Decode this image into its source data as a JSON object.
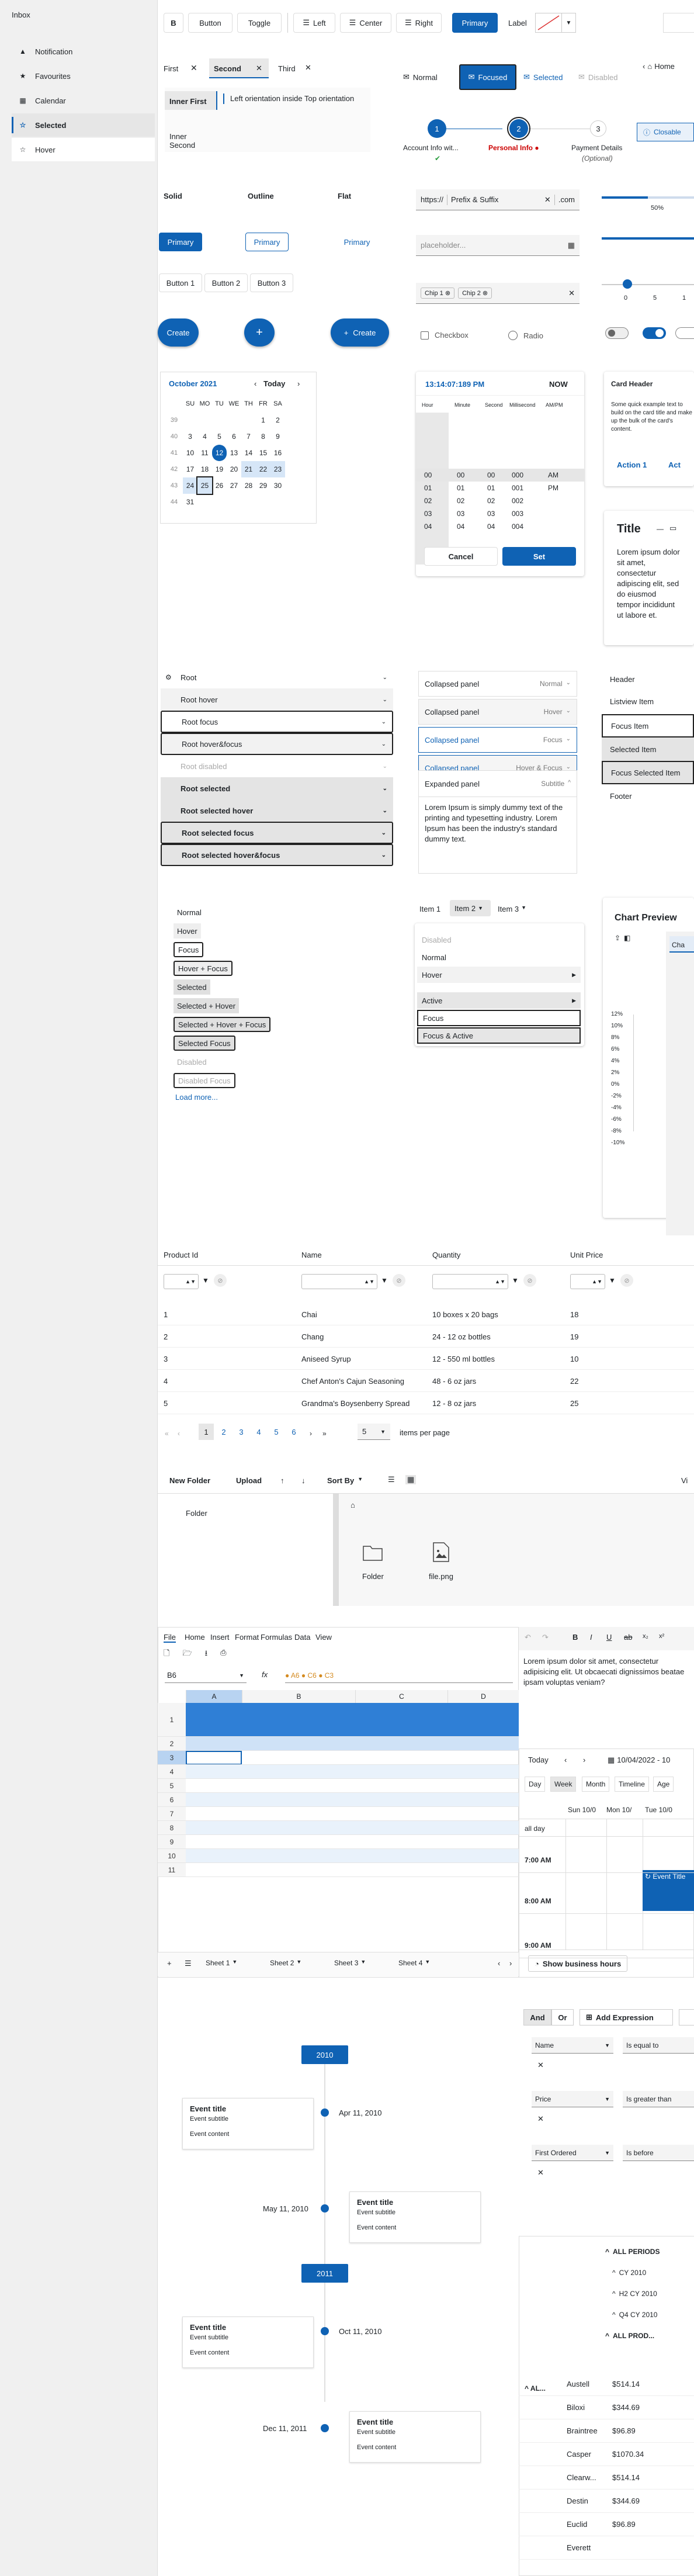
{
  "drawer": {
    "title": "Inbox",
    "items": [
      {
        "label": "Notification",
        "icon": "bell-icon",
        "glyph": "▲"
      },
      {
        "label": "Favourites",
        "icon": "star-icon",
        "glyph": "★"
      },
      {
        "label": "Calendar",
        "icon": "calendar-icon",
        "glyph": "▦"
      },
      {
        "label": "Selected",
        "icon": "star-outline-icon",
        "glyph": "☆"
      },
      {
        "label": "Hover",
        "icon": "star-outline-icon",
        "glyph": "☆"
      }
    ]
  },
  "toolbar": {
    "bold": "B",
    "button": "Button",
    "toggle": "Toggle",
    "left": "Left",
    "center": "Center",
    "right": "Right",
    "primary": "Primary",
    "label": "Label"
  },
  "tabs": {
    "row1": [
      "First",
      "Second",
      "Third"
    ],
    "inner": [
      "Inner First",
      "Inner Second"
    ],
    "inner_content": "Left orientation inside Top orientation"
  },
  "chips_row": {
    "normal": "Normal",
    "focused": "Focused",
    "selected": "Selected",
    "disabled": "Disabled"
  },
  "breadcrumb": {
    "home": "Home"
  },
  "stepper": [
    {
      "num": "1",
      "label": "Account Info wit...",
      "sub": ""
    },
    {
      "num": "2",
      "label": "Personal Info",
      "sub": ""
    },
    {
      "num": "3",
      "label": "Payment Details",
      "sub": "(Optional)"
    }
  ],
  "closable": "Closable",
  "buttons": {
    "solid": "Solid",
    "outline": "Outline",
    "flat": "Flat",
    "primary_solid": "Primary",
    "primary_outline": "Primary",
    "primary_flat": "Primary",
    "group": [
      "Button 1",
      "Button 2",
      "Button 3"
    ],
    "fab_create": "Create",
    "fab_plus": "+",
    "fab_create2": "Create"
  },
  "inputs": {
    "prefix": "https://",
    "suffix_text": "Prefix & Suffix",
    "suffix": ".com",
    "placeholder": "placeholder...",
    "chips": [
      "Chip 1",
      "Chip 2"
    ],
    "checkbox": "Checkbox",
    "radio": "Radio"
  },
  "progress": {
    "label": "50%",
    "value": 0.5
  },
  "slider": {
    "ticks": [
      "0",
      "5",
      "1"
    ]
  },
  "calendar": {
    "month": "October 2021",
    "today": "Today",
    "days": [
      "SU",
      "MO",
      "TU",
      "WE",
      "TH",
      "FR",
      "SA"
    ],
    "weeks": [
      {
        "w": "39",
        "d": [
          "",
          "",
          "",
          "",
          "",
          "1",
          "2"
        ]
      },
      {
        "w": "40",
        "d": [
          "3",
          "4",
          "5",
          "6",
          "7",
          "8",
          "9"
        ]
      },
      {
        "w": "41",
        "d": [
          "10",
          "11",
          "12",
          "13",
          "14",
          "15",
          "16"
        ]
      },
      {
        "w": "42",
        "d": [
          "17",
          "18",
          "19",
          "20",
          "21",
          "22",
          "23"
        ]
      },
      {
        "w": "43",
        "d": [
          "24",
          "25",
          "26",
          "27",
          "28",
          "29",
          "30"
        ]
      },
      {
        "w": "44",
        "d": [
          "31",
          "",
          "",
          "",
          "",
          "",
          ""
        ]
      }
    ]
  },
  "time_picker": {
    "value": "13:14:07:189 PM",
    "now": "NOW",
    "headers": [
      "Hour",
      "Minute",
      "Second",
      "Millisecond",
      "AM/PM"
    ],
    "rows": [
      [
        "00",
        "00",
        "00",
        "000",
        "AM"
      ],
      [
        "01",
        "01",
        "01",
        "001",
        "PM"
      ],
      [
        "02",
        "02",
        "02",
        "002",
        ""
      ],
      [
        "03",
        "03",
        "03",
        "003",
        ""
      ],
      [
        "04",
        "04",
        "04",
        "004",
        ""
      ]
    ],
    "cancel": "Cancel",
    "set": "Set"
  },
  "card": {
    "header": "Card Header",
    "body": "Some quick example text to build on the card title and make up the bulk of the card's content.",
    "action1": "Action 1",
    "action2": "Act"
  },
  "dialog": {
    "title": "Title",
    "body": "Lorem ipsum dolor sit amet, consectetur adipiscing elit, sed do eiusmod tempor incididunt ut labore et."
  },
  "tree": {
    "items": [
      "Root",
      "Root hover",
      "Root focus",
      "Root hover&focus",
      "Root disabled",
      "Root selected",
      "Root selected hover",
      "Root selected focus",
      "Root selected hover&focus"
    ]
  },
  "panels": {
    "items": [
      {
        "label": "Collapsed panel",
        "state": "Normal"
      },
      {
        "label": "Collapsed panel",
        "state": "Hover"
      },
      {
        "label": "Collapsed panel",
        "state": "Focus"
      },
      {
        "label": "Collapsed panel",
        "state": "Hover & Focus"
      },
      {
        "label": "Expanded panel",
        "state": "Subtitle"
      }
    ],
    "content": "Lorem Ipsum is simply dummy text of the printing and typesetting industry. Lorem Ipsum has been the industry's standard dummy text."
  },
  "listview": {
    "items": [
      "Header",
      "Listview Item",
      "Focus Item",
      "Selected Item",
      "Focus Selected Item",
      "Footer"
    ]
  },
  "list": {
    "items": [
      "Normal",
      "Hover",
      "Focus",
      "Hover + Focus",
      "Selected",
      "Selected + Hover",
      "Selected + Hover + Focus",
      "Selected Focus",
      "Disabled",
      "Disabled Focus"
    ],
    "load_more": "Load more..."
  },
  "menu": {
    "bar": [
      "Item 1",
      "Item 2",
      "Item 3"
    ],
    "items": [
      "Disabled",
      "Normal",
      "Hover",
      "Active",
      "Focus",
      "Focus & Active"
    ]
  },
  "chart_preview": {
    "title": "Chart Preview",
    "tab": "Cha",
    "ticks": [
      "12%",
      "10%",
      "8%",
      "6%",
      "4%",
      "2%",
      "0%",
      "-2%",
      "-4%",
      "-6%",
      "-8%",
      "-10%"
    ]
  },
  "grid": {
    "headers": [
      "Product Id",
      "Name",
      "Quantity",
      "Unit Price"
    ],
    "rows": [
      [
        "1",
        "Chai",
        "10 boxes x 20 bags",
        "18"
      ],
      [
        "2",
        "Chang",
        "24 - 12 oz bottles",
        "19"
      ],
      [
        "3",
        "Aniseed Syrup",
        "12 - 550 ml bottles",
        "10"
      ],
      [
        "4",
        "Chef Anton's Cajun Seasoning",
        "48 - 6 oz jars",
        "22"
      ],
      [
        "5",
        "Grandma's Boysenberry Spread",
        "12 - 8 oz jars",
        "25"
      ]
    ],
    "pages": [
      "1",
      "2",
      "3",
      "4",
      "5",
      "6"
    ],
    "page_size": "5",
    "per_page": "items per page"
  },
  "file_manager": {
    "new_folder": "New Folder",
    "upload": "Upload",
    "sort_by": "Sort By",
    "view": "Vi",
    "tree_item": "Folder",
    "files": [
      {
        "name": "Folder",
        "icon": "folder-icon"
      },
      {
        "name": "file.png",
        "icon": "image-icon"
      }
    ]
  },
  "spreadsheet": {
    "menu": [
      "File",
      "Home",
      "Insert",
      "Format",
      "Formulas",
      "Data",
      "View"
    ],
    "cell_ref": "B6",
    "fx": "fx",
    "columns": [
      "A",
      "B",
      "C",
      "D"
    ],
    "rows": [
      "1",
      "2",
      "3",
      "4",
      "5",
      "6",
      "7",
      "8",
      "9",
      "10",
      "11"
    ],
    "sheets": [
      "Sheet 1",
      "Sheet 2",
      "Sheet 3",
      "Sheet 4"
    ]
  },
  "editor": {
    "text": "Lorem ipsum dolor sit amet, consectetur adipisicing elit. Ut obcaecati dignissimos beatae ipsam voluptas veniam?"
  },
  "scheduler": {
    "today": "Today",
    "date": "10/04/2022 - 10",
    "views": [
      "Day",
      "Week",
      "Month",
      "Timeline",
      "Age"
    ],
    "cols": [
      "Sun 10/0",
      "Mon 10/",
      "Tue 10/0"
    ],
    "all_day": "all day",
    "times": [
      "7:00 AM",
      "8:00 AM",
      "9:00 AM"
    ],
    "event": "Event Title",
    "business": "Show business hours"
  },
  "filter": {
    "and": "And",
    "or": "Or",
    "add": "Add Expression",
    "rows": [
      {
        "field": "Name",
        "op": "Is equal to"
      },
      {
        "field": "Price",
        "op": "Is greater than"
      },
      {
        "field": "First Ordered",
        "op": "Is before"
      }
    ]
  },
  "timeline": {
    "years": [
      "2010",
      "2011"
    ],
    "events": [
      {
        "date": "Apr 11, 2010",
        "title": "Event title",
        "subtitle": "Event subtitle",
        "content": "Event content"
      },
      {
        "date": "May 11, 2010",
        "title": "Event title",
        "subtitle": "Event subtitle",
        "content": "Event content"
      },
      {
        "date": "Oct 11, 2010",
        "title": "Event title",
        "subtitle": "Event subtitle",
        "content": "Event content"
      },
      {
        "date": "Dec 11, 2011",
        "title": "Event title",
        "subtitle": "Event subtitle",
        "content": "Event content"
      }
    ]
  },
  "pivot": {
    "headers": [
      "ALL PERIODS",
      "CY 2010",
      "H2 CY 2010",
      "Q4 CY 2010",
      "ALL PROD..."
    ],
    "row_header": "AL...",
    "rows": [
      {
        "name": "Austell",
        "value": "$514.14"
      },
      {
        "name": "Biloxi",
        "value": "$344.69"
      },
      {
        "name": "Braintree",
        "value": "$96.89"
      },
      {
        "name": "Casper",
        "value": "$1070.34"
      },
      {
        "name": "Clearw...",
        "value": "$514.14"
      },
      {
        "name": "Destin",
        "value": "$344.69"
      },
      {
        "name": "Euclid",
        "value": "$96.89"
      },
      {
        "name": "Everett",
        "value": ""
      }
    ]
  }
}
